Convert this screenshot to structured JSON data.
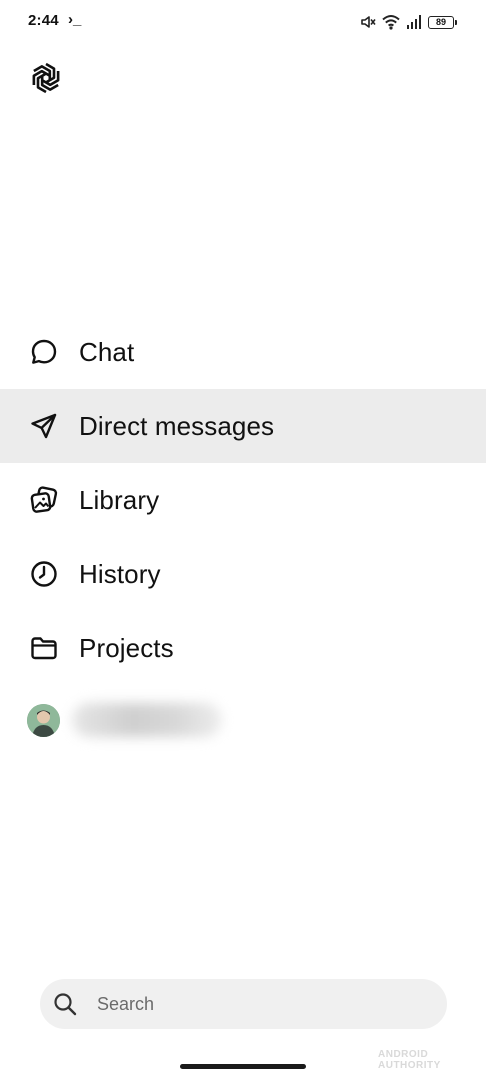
{
  "status_bar": {
    "time": "2:44",
    "prompt": "›_",
    "battery": "89",
    "icons": [
      "mute-icon",
      "wifi-icon",
      "signal-icon",
      "battery-icon"
    ]
  },
  "app": {
    "logo_icon": "openai-logo-icon"
  },
  "nav": {
    "items": [
      {
        "label": "Chat",
        "icon": "chat-bubble-icon",
        "active": false
      },
      {
        "label": "Direct messages",
        "icon": "paper-plane-icon",
        "active": true
      },
      {
        "label": "Library",
        "icon": "images-icon",
        "active": false
      },
      {
        "label": "History",
        "icon": "clock-icon",
        "active": false
      },
      {
        "label": "Projects",
        "icon": "folder-icon",
        "active": false
      }
    ]
  },
  "profile": {
    "avatar_icon": "user-avatar"
  },
  "search": {
    "label": "Search",
    "icon": "search-icon"
  },
  "watermark": "ANDROID AUTHORITY",
  "colors": {
    "background": "#ffffff",
    "active_row": "#ececec",
    "search_bg": "#f0f0f0",
    "text": "#111111",
    "muted_text": "#6b6b6b"
  }
}
